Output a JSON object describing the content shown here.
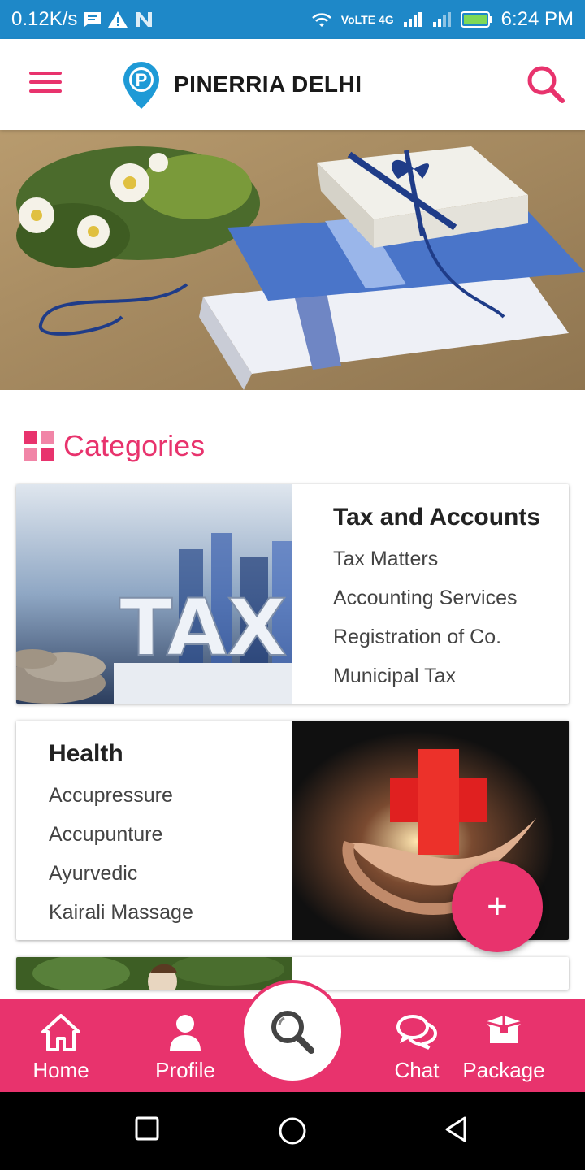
{
  "status_bar": {
    "speed": "0.12K/s",
    "network": "VoLTE 4G",
    "time": "6:24 PM"
  },
  "app_bar": {
    "title": "PINERRIA DELHI",
    "logo_letter": "P",
    "menu_icon": "hamburger-menu-icon",
    "search_icon": "search-icon"
  },
  "categories": {
    "heading": "Categories",
    "cards": [
      {
        "title": "Tax and Accounts",
        "items": [
          "Tax Matters",
          "Accounting Services",
          "Registration of Co.",
          "Municipal Tax"
        ],
        "image_text": "TAX"
      },
      {
        "title": "Health",
        "items": [
          "Accupressure",
          "Accupunture",
          "Ayurvedic",
          "Kairali Massage"
        ]
      }
    ]
  },
  "fab": {
    "label": "+"
  },
  "bottom_nav": {
    "items": [
      {
        "label": "Home",
        "icon": "home-icon"
      },
      {
        "label": "Profile",
        "icon": "profile-icon"
      },
      {
        "label": "Chat",
        "icon": "chat-icon"
      },
      {
        "label": "Package",
        "icon": "package-icon"
      }
    ],
    "center_icon": "search-icon"
  },
  "colors": {
    "status_bar": "#1e88c8",
    "accent": "#e8336d",
    "logo_blue": "#1e9ad6"
  }
}
